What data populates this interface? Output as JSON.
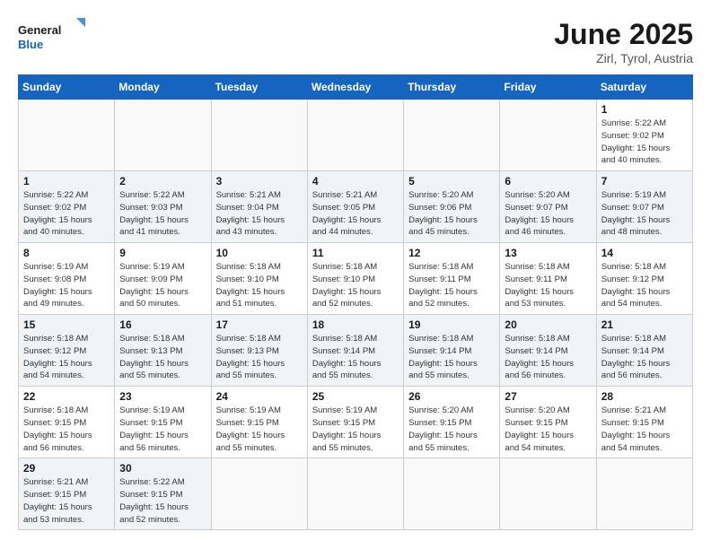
{
  "header": {
    "logo_text_general": "General",
    "logo_text_blue": "Blue",
    "month_title": "June 2025",
    "location": "Zirl, Tyrol, Austria"
  },
  "calendar": {
    "days_of_week": [
      "Sunday",
      "Monday",
      "Tuesday",
      "Wednesday",
      "Thursday",
      "Friday",
      "Saturday"
    ],
    "weeks": [
      [
        {
          "day": "",
          "info": ""
        },
        {
          "day": "",
          "info": ""
        },
        {
          "day": "",
          "info": ""
        },
        {
          "day": "",
          "info": ""
        },
        {
          "day": "",
          "info": ""
        },
        {
          "day": "",
          "info": ""
        },
        {
          "day": "1",
          "info": "Sunrise: 5:22 AM\nSunset: 9:02 PM\nDaylight: 15 hours\nand 40 minutes."
        }
      ],
      [
        {
          "day": "1",
          "info": "Sunrise: 5:22 AM\nSunset: 9:02 PM\nDaylight: 15 hours\nand 40 minutes."
        },
        {
          "day": "2",
          "info": "Sunrise: 5:22 AM\nSunset: 9:03 PM\nDaylight: 15 hours\nand 41 minutes."
        },
        {
          "day": "3",
          "info": "Sunrise: 5:21 AM\nSunset: 9:04 PM\nDaylight: 15 hours\nand 43 minutes."
        },
        {
          "day": "4",
          "info": "Sunrise: 5:21 AM\nSunset: 9:05 PM\nDaylight: 15 hours\nand 44 minutes."
        },
        {
          "day": "5",
          "info": "Sunrise: 5:20 AM\nSunset: 9:06 PM\nDaylight: 15 hours\nand 45 minutes."
        },
        {
          "day": "6",
          "info": "Sunrise: 5:20 AM\nSunset: 9:07 PM\nDaylight: 15 hours\nand 46 minutes."
        },
        {
          "day": "7",
          "info": "Sunrise: 5:19 AM\nSunset: 9:07 PM\nDaylight: 15 hours\nand 48 minutes."
        }
      ],
      [
        {
          "day": "8",
          "info": "Sunrise: 5:19 AM\nSunset: 9:08 PM\nDaylight: 15 hours\nand 49 minutes."
        },
        {
          "day": "9",
          "info": "Sunrise: 5:19 AM\nSunset: 9:09 PM\nDaylight: 15 hours\nand 50 minutes."
        },
        {
          "day": "10",
          "info": "Sunrise: 5:18 AM\nSunset: 9:10 PM\nDaylight: 15 hours\nand 51 minutes."
        },
        {
          "day": "11",
          "info": "Sunrise: 5:18 AM\nSunset: 9:10 PM\nDaylight: 15 hours\nand 52 minutes."
        },
        {
          "day": "12",
          "info": "Sunrise: 5:18 AM\nSunset: 9:11 PM\nDaylight: 15 hours\nand 52 minutes."
        },
        {
          "day": "13",
          "info": "Sunrise: 5:18 AM\nSunset: 9:11 PM\nDaylight: 15 hours\nand 53 minutes."
        },
        {
          "day": "14",
          "info": "Sunrise: 5:18 AM\nSunset: 9:12 PM\nDaylight: 15 hours\nand 54 minutes."
        }
      ],
      [
        {
          "day": "15",
          "info": "Sunrise: 5:18 AM\nSunset: 9:12 PM\nDaylight: 15 hours\nand 54 minutes."
        },
        {
          "day": "16",
          "info": "Sunrise: 5:18 AM\nSunset: 9:13 PM\nDaylight: 15 hours\nand 55 minutes."
        },
        {
          "day": "17",
          "info": "Sunrise: 5:18 AM\nSunset: 9:13 PM\nDaylight: 15 hours\nand 55 minutes."
        },
        {
          "day": "18",
          "info": "Sunrise: 5:18 AM\nSunset: 9:14 PM\nDaylight: 15 hours\nand 55 minutes."
        },
        {
          "day": "19",
          "info": "Sunrise: 5:18 AM\nSunset: 9:14 PM\nDaylight: 15 hours\nand 55 minutes."
        },
        {
          "day": "20",
          "info": "Sunrise: 5:18 AM\nSunset: 9:14 PM\nDaylight: 15 hours\nand 56 minutes."
        },
        {
          "day": "21",
          "info": "Sunrise: 5:18 AM\nSunset: 9:14 PM\nDaylight: 15 hours\nand 56 minutes."
        }
      ],
      [
        {
          "day": "22",
          "info": "Sunrise: 5:18 AM\nSunset: 9:15 PM\nDaylight: 15 hours\nand 56 minutes."
        },
        {
          "day": "23",
          "info": "Sunrise: 5:19 AM\nSunset: 9:15 PM\nDaylight: 15 hours\nand 56 minutes."
        },
        {
          "day": "24",
          "info": "Sunrise: 5:19 AM\nSunset: 9:15 PM\nDaylight: 15 hours\nand 55 minutes."
        },
        {
          "day": "25",
          "info": "Sunrise: 5:19 AM\nSunset: 9:15 PM\nDaylight: 15 hours\nand 55 minutes."
        },
        {
          "day": "26",
          "info": "Sunrise: 5:20 AM\nSunset: 9:15 PM\nDaylight: 15 hours\nand 55 minutes."
        },
        {
          "day": "27",
          "info": "Sunrise: 5:20 AM\nSunset: 9:15 PM\nDaylight: 15 hours\nand 54 minutes."
        },
        {
          "day": "28",
          "info": "Sunrise: 5:21 AM\nSunset: 9:15 PM\nDaylight: 15 hours\nand 54 minutes."
        }
      ],
      [
        {
          "day": "29",
          "info": "Sunrise: 5:21 AM\nSunset: 9:15 PM\nDaylight: 15 hours\nand 53 minutes."
        },
        {
          "day": "30",
          "info": "Sunrise: 5:22 AM\nSunset: 9:15 PM\nDaylight: 15 hours\nand 52 minutes."
        },
        {
          "day": "",
          "info": ""
        },
        {
          "day": "",
          "info": ""
        },
        {
          "day": "",
          "info": ""
        },
        {
          "day": "",
          "info": ""
        },
        {
          "day": "",
          "info": ""
        }
      ]
    ]
  }
}
